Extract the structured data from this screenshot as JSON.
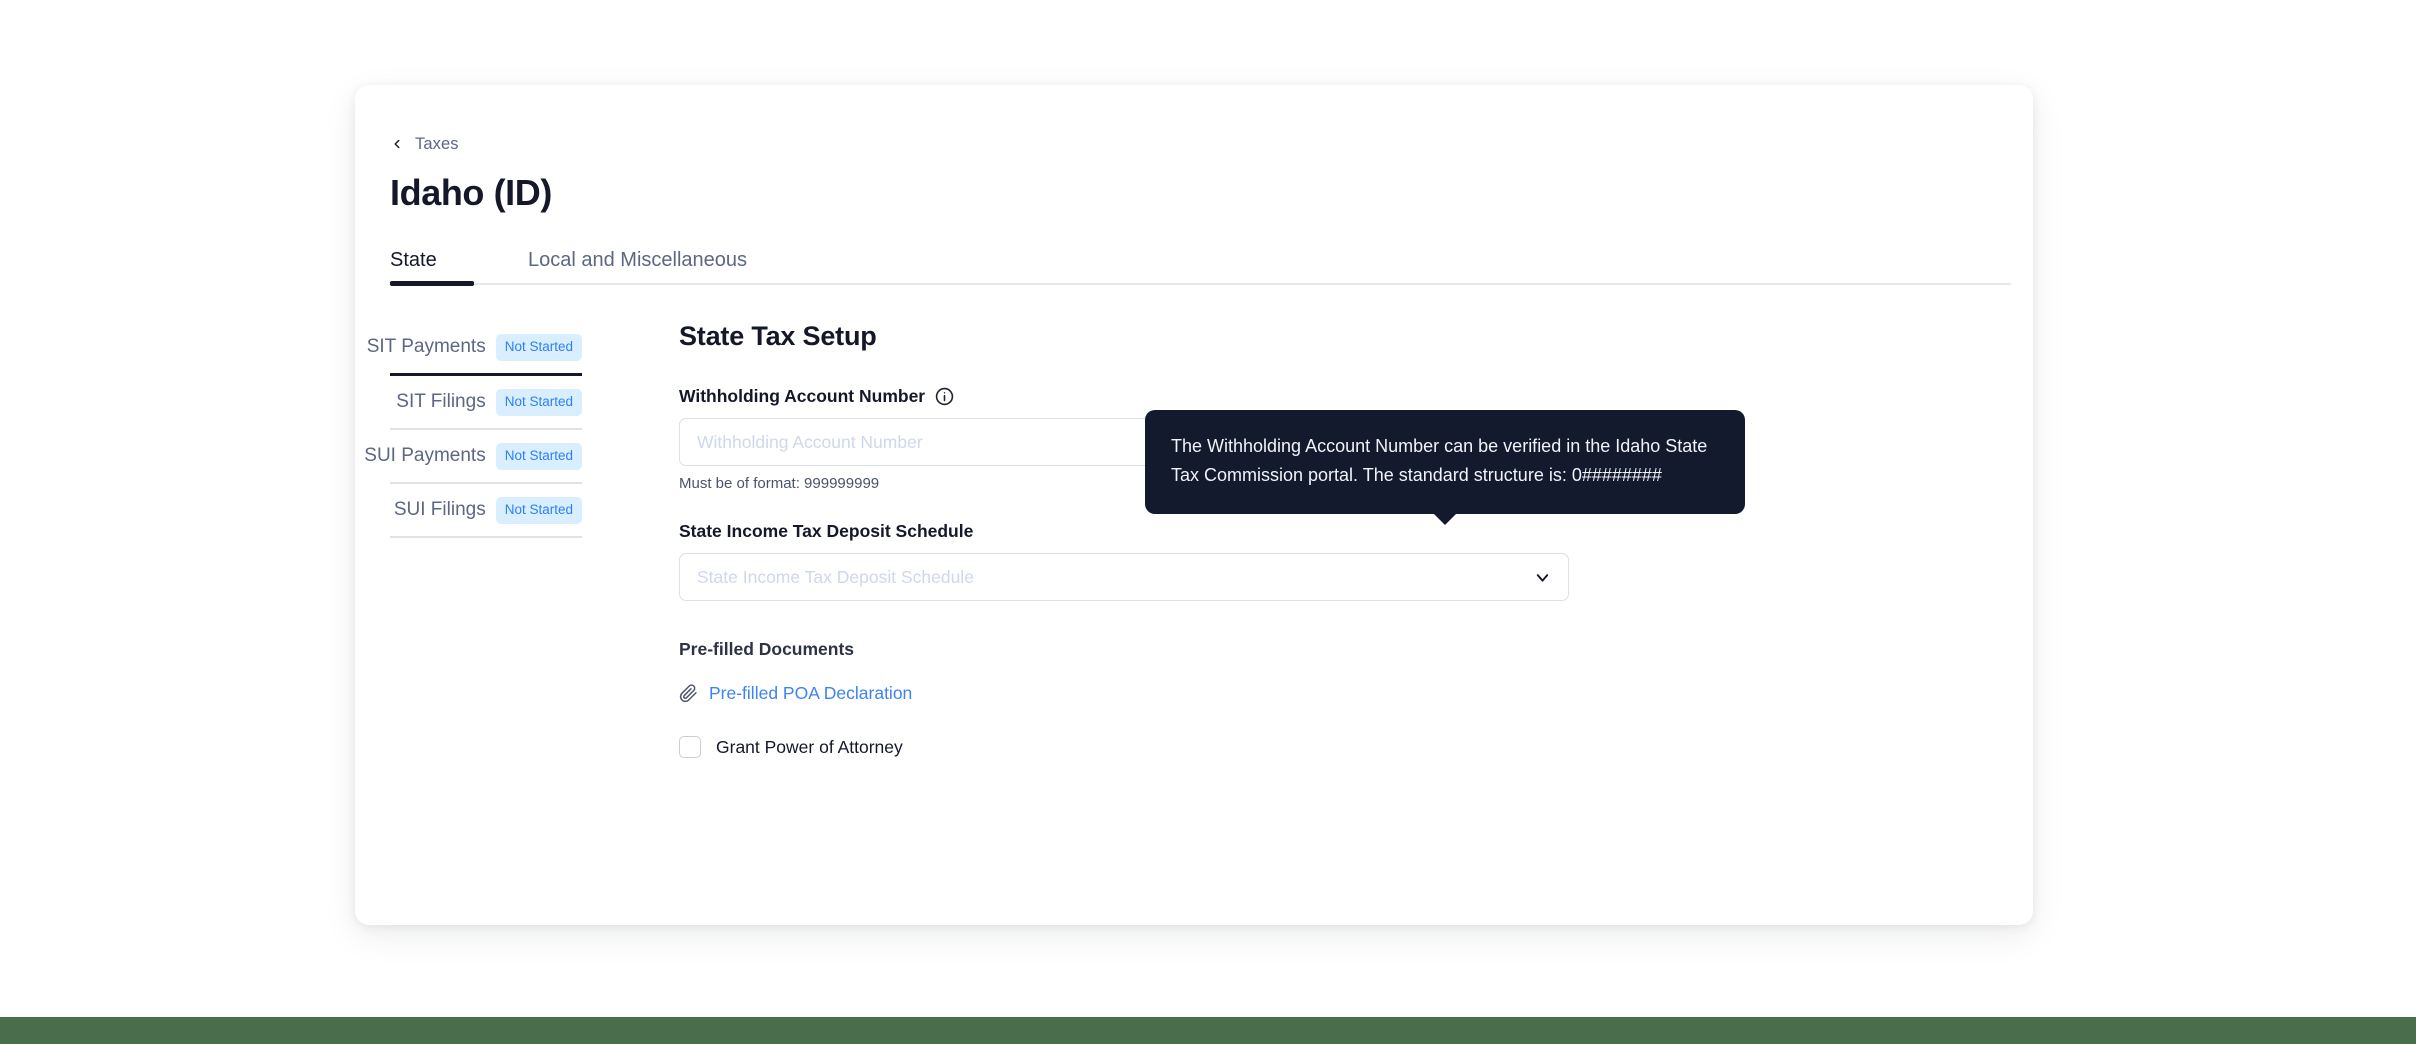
{
  "breadcrumb": {
    "back_icon": "chevron-left-icon",
    "label": "Taxes"
  },
  "page_title": "Idaho (ID)",
  "tabs": [
    {
      "label": "State",
      "active": true
    },
    {
      "label": "Local and Miscellaneous",
      "active": false
    }
  ],
  "sidebar": {
    "items": [
      {
        "label": "SIT Payments",
        "badge": "Not Started",
        "active": true
      },
      {
        "label": "SIT Filings",
        "badge": "Not Started",
        "active": false
      },
      {
        "label": "SUI Payments",
        "badge": "Not Started",
        "active": false
      },
      {
        "label": "SUI Filings",
        "badge": "Not Started",
        "active": false
      }
    ]
  },
  "form": {
    "section_heading": "State Tax Setup",
    "withholding": {
      "label": "Withholding Account Number",
      "info_icon": "info-circle-icon",
      "value": "",
      "placeholder": "Withholding Account Number",
      "help_text": "Must be of format: 999999999"
    },
    "deposit_schedule": {
      "label": "State Income Tax Deposit Schedule",
      "placeholder": "State Income Tax Deposit Schedule",
      "value": "",
      "chevron_icon": "chevron-down-icon"
    },
    "documents": {
      "heading": "Pre-filled Documents",
      "attachment_icon": "paperclip-icon",
      "link_label": "Pre-filled POA Declaration"
    },
    "grant_poa": {
      "label": "Grant Power of Attorney",
      "checked": false
    }
  },
  "tooltip": {
    "text": "The Withholding Account Number can be verified in the Idaho State Tax Commission portal. The standard structure is: 0########"
  },
  "colors": {
    "accent_link": "#3d83f5",
    "badge_bg": "#d9eeff",
    "badge_text": "#2d7ff9",
    "tooltip_bg": "#141a2e",
    "bottom_strip": "#4a6e4c",
    "active_underline": "#141828"
  }
}
